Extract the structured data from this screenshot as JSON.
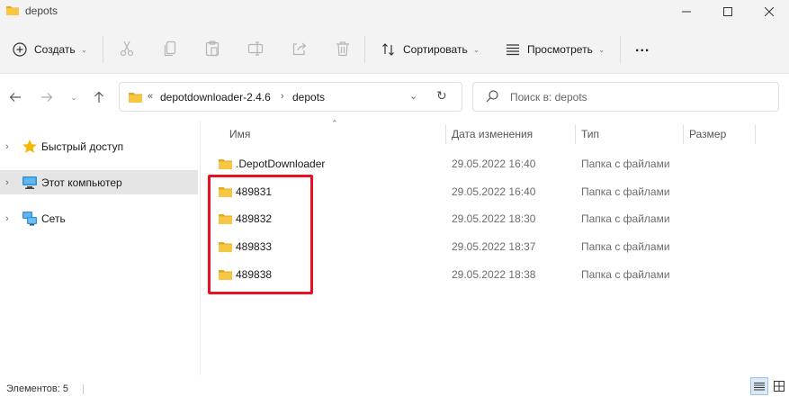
{
  "window": {
    "title": "depots"
  },
  "toolbar": {
    "new_label": "Создать",
    "sort_label": "Сортировать",
    "view_label": "Просмотреть",
    "more_label": "..."
  },
  "address": {
    "overflow": "«",
    "crumbs": [
      "depotdownloader-2.4.6",
      "depots"
    ]
  },
  "search": {
    "placeholder": "Поиск в: depots"
  },
  "sidebar": {
    "items": [
      {
        "label": "Быстрый доступ",
        "icon": "star-icon"
      },
      {
        "label": "Этот компьютер",
        "icon": "computer-icon",
        "selected": true
      },
      {
        "label": "Сеть",
        "icon": "network-icon"
      }
    ]
  },
  "columns": {
    "name": "Имя",
    "date": "Дата изменения",
    "type": "Тип",
    "size": "Размер"
  },
  "files": [
    {
      "name": ".DepotDownloader",
      "date": "29.05.2022 16:40",
      "type": "Папка с файлами"
    },
    {
      "name": "489831",
      "date": "29.05.2022 16:40",
      "type": "Папка с файлами"
    },
    {
      "name": "489832",
      "date": "29.05.2022 18:30",
      "type": "Папка с файлами"
    },
    {
      "name": "489833",
      "date": "29.05.2022 18:37",
      "type": "Папка с файлами"
    },
    {
      "name": "489838",
      "date": "29.05.2022 18:38",
      "type": "Папка с файлами"
    }
  ],
  "status": {
    "count": "Элементов: 5"
  },
  "colors": {
    "folder": "#f7c744",
    "folder_dark": "#e3a921",
    "highlight": "#e81123",
    "selected_bg": "#e5e5e5"
  }
}
